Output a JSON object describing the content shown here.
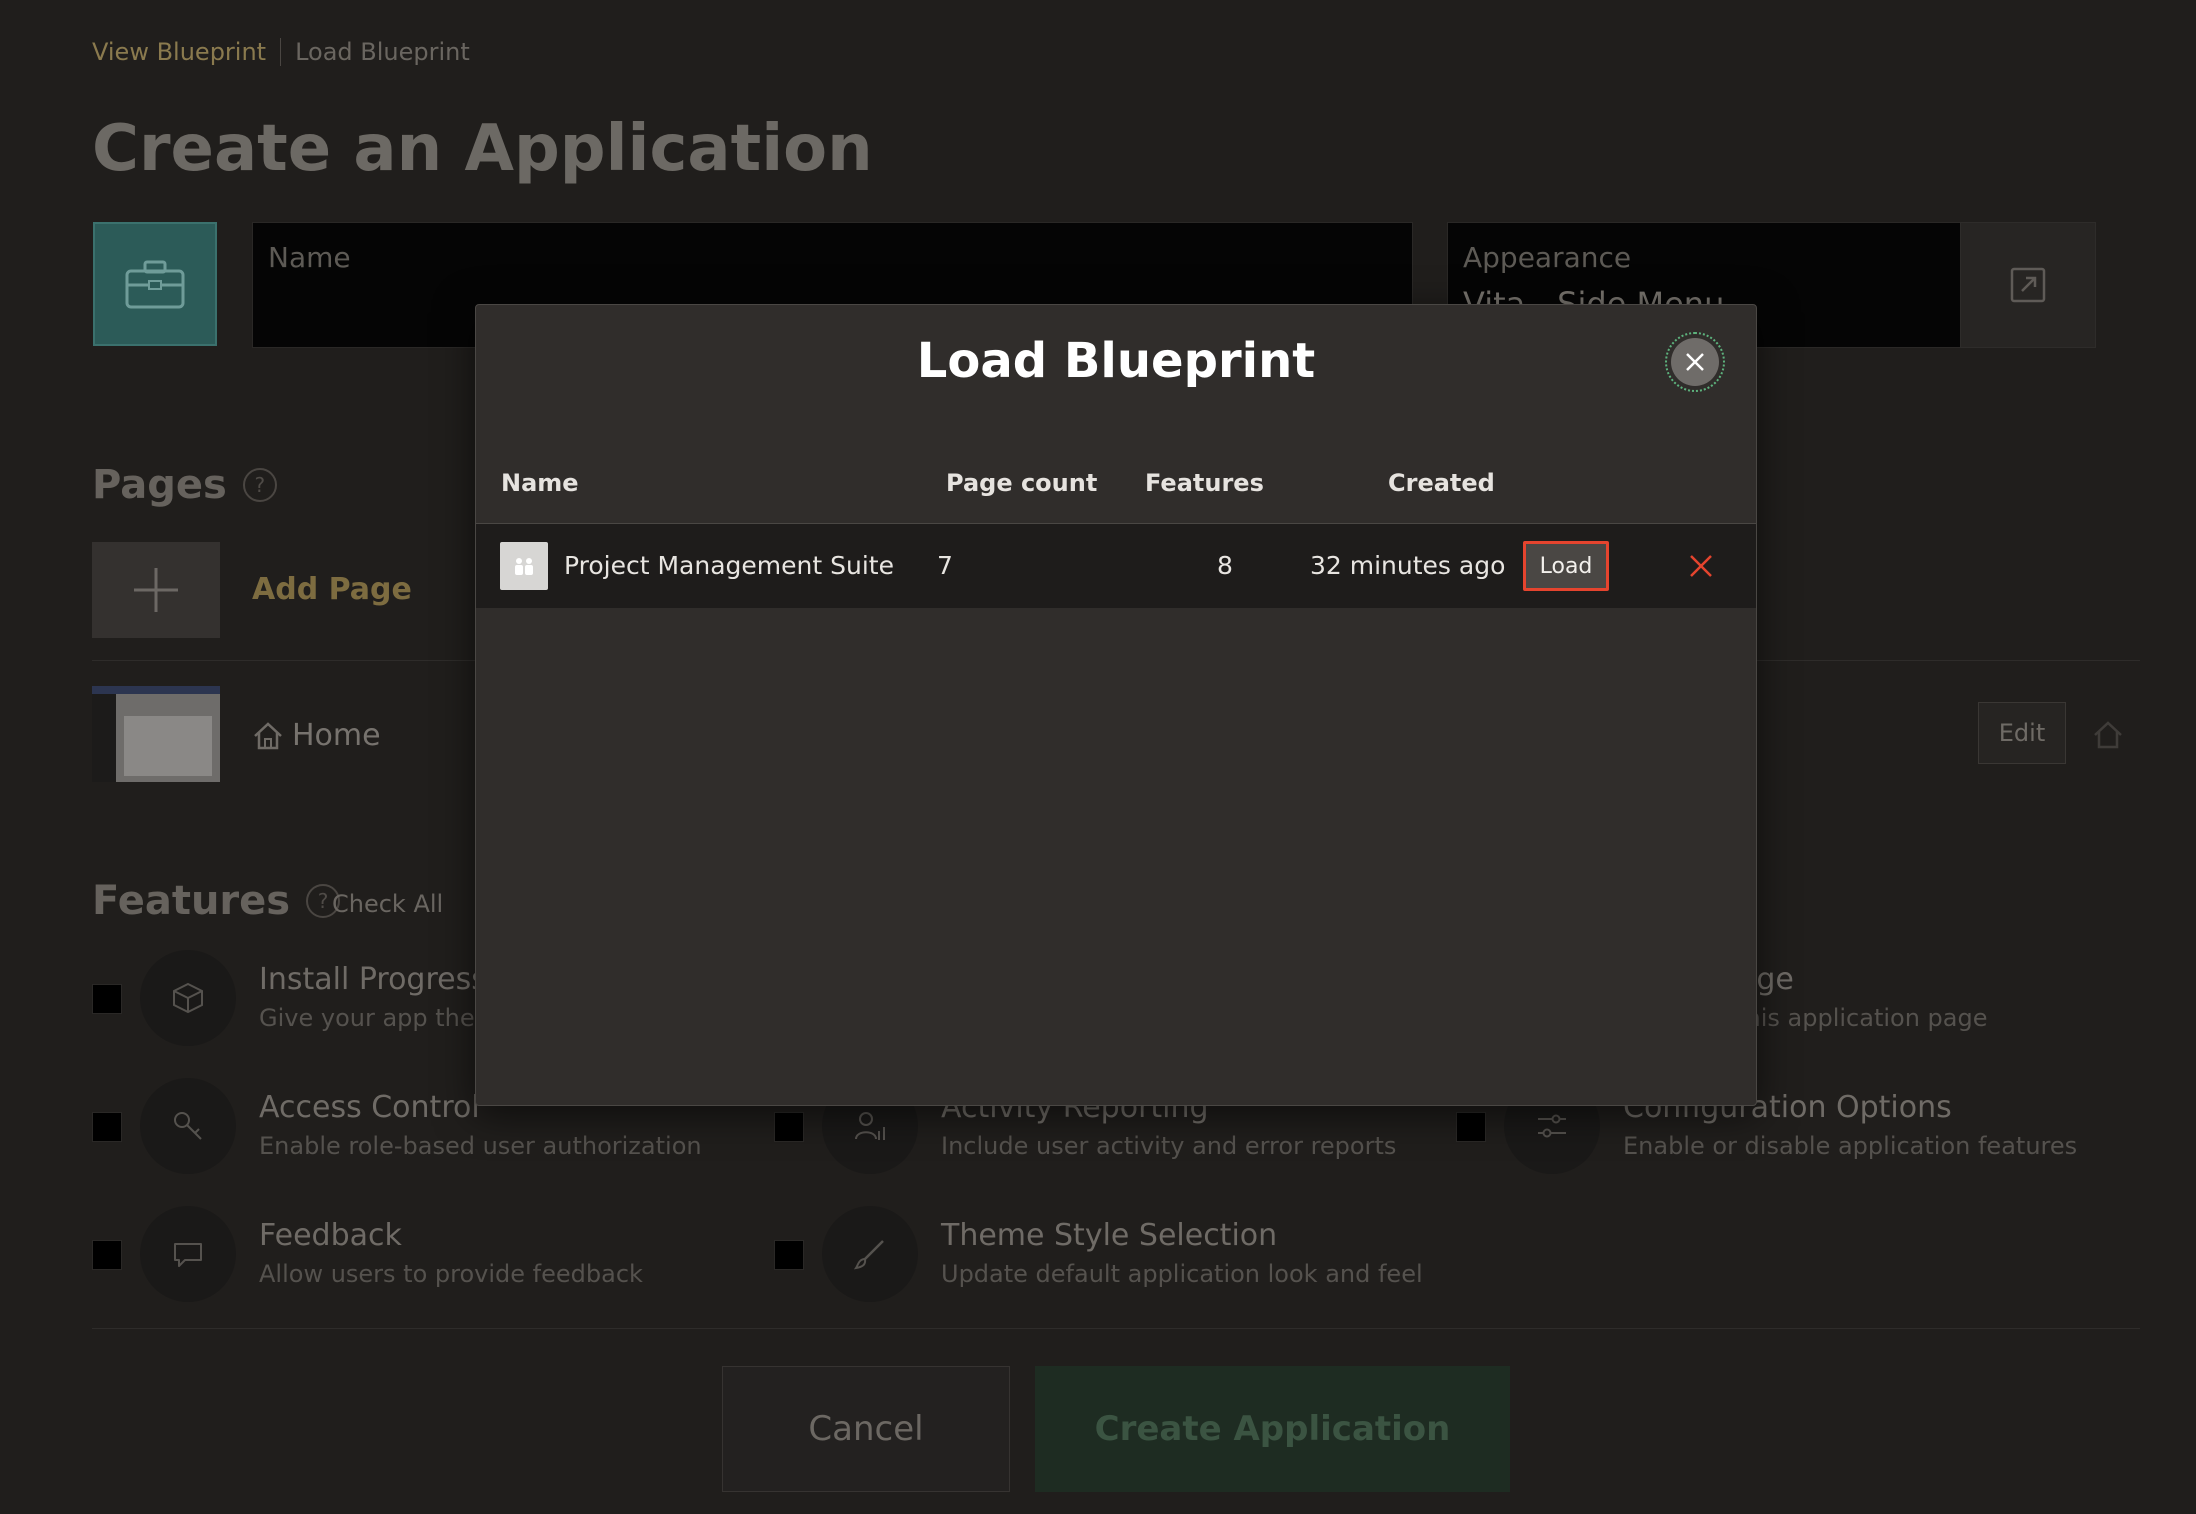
{
  "breadcrumb": {
    "link": "View Blueprint",
    "current": "Load Blueprint"
  },
  "page_title": "Create an Application",
  "name_field": {
    "label": "Name"
  },
  "appearance": {
    "label": "Appearance",
    "value": "Vita - Side Menu"
  },
  "pages": {
    "heading": "Pages",
    "help": "?",
    "add_label": "Add Page",
    "home_label": "Home",
    "edit_label": "Edit"
  },
  "features": {
    "heading": "Features",
    "help": "?",
    "check_all": "Check All",
    "items": [
      {
        "title": "Install Progressive Web App",
        "desc": "Give your app the ability to be installed"
      },
      {
        "title": "About Page",
        "desc": "Describe this application page"
      },
      {
        "title": "Access Control",
        "desc": "Enable role-based user authorization"
      },
      {
        "title": "Activity Reporting",
        "desc": "Include user activity and error reports"
      },
      {
        "title": "Configuration Options",
        "desc": "Enable or disable application features"
      },
      {
        "title": "Feedback",
        "desc": "Allow users to provide feedback"
      },
      {
        "title": "Theme Style Selection",
        "desc": "Update default application look and feel"
      }
    ]
  },
  "actions": {
    "cancel": "Cancel",
    "create": "Create Application"
  },
  "modal": {
    "title": "Load Blueprint",
    "columns": {
      "name": "Name",
      "page_count": "Page count",
      "features": "Features",
      "created": "Created"
    },
    "rows": [
      {
        "name": "Project Management Suite",
        "page_count": "7",
        "features": "8",
        "created": "32 minutes ago",
        "load": "Load"
      }
    ]
  },
  "colors": {
    "accent_gold": "#8a7a4e",
    "highlight_red": "#e5442e",
    "focus_green": "#5db27d",
    "app_icon_teal": "#2c5b58"
  }
}
